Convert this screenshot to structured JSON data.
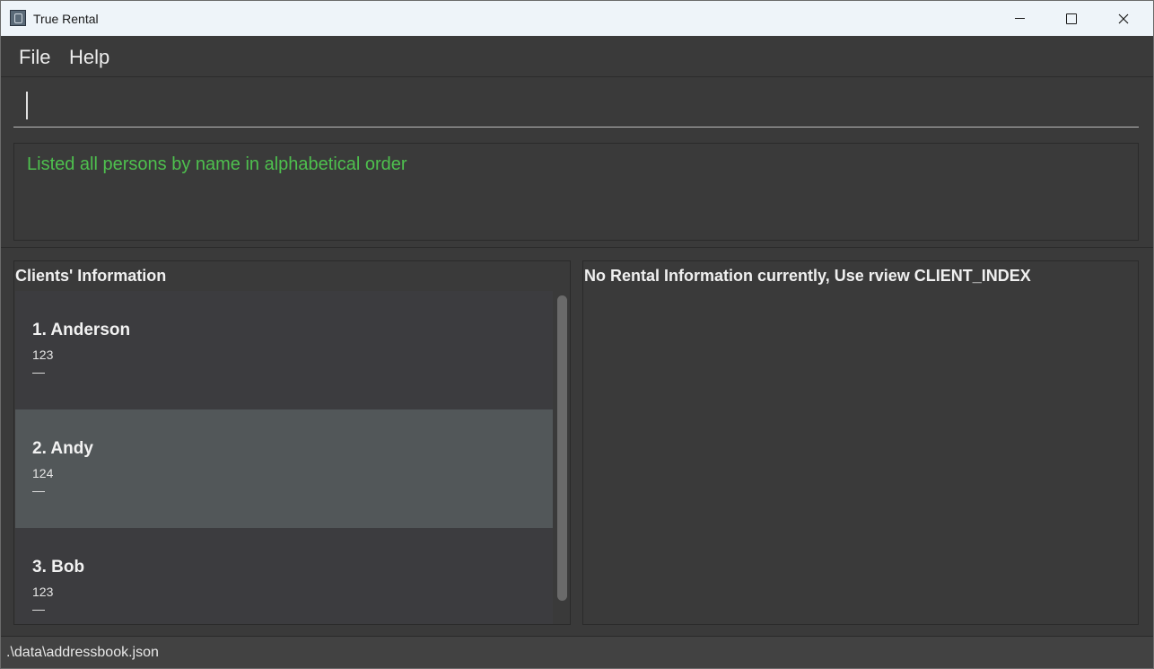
{
  "window": {
    "title": "True Rental"
  },
  "icons": {
    "app": "app-icon",
    "minimize": "minimize-icon",
    "maximize": "maximize-icon",
    "close": "close-icon"
  },
  "menu": {
    "file_label": "File",
    "help_label": "Help"
  },
  "command": {
    "value": ""
  },
  "result": {
    "message": "Listed all persons by name in alphabetical order"
  },
  "clients_panel": {
    "title": "Clients' Information",
    "clients": [
      {
        "name": "1. Anderson",
        "phone": "123",
        "extra": "—",
        "selected": false
      },
      {
        "name": "2. Andy",
        "phone": "124",
        "extra": "—",
        "selected": true
      },
      {
        "name": "3. Bob",
        "phone": "123",
        "extra": "—",
        "selected": false
      }
    ]
  },
  "rental_panel": {
    "title": "No Rental Information currently, Use rview CLIENT_INDEX"
  },
  "status_bar": {
    "path": ".\\data\\addressbook.json"
  },
  "colors": {
    "result_text": "#4ec04e",
    "background": "#3a3a3a",
    "selected_card": "#525759",
    "titlebar": "#eef4f9"
  }
}
